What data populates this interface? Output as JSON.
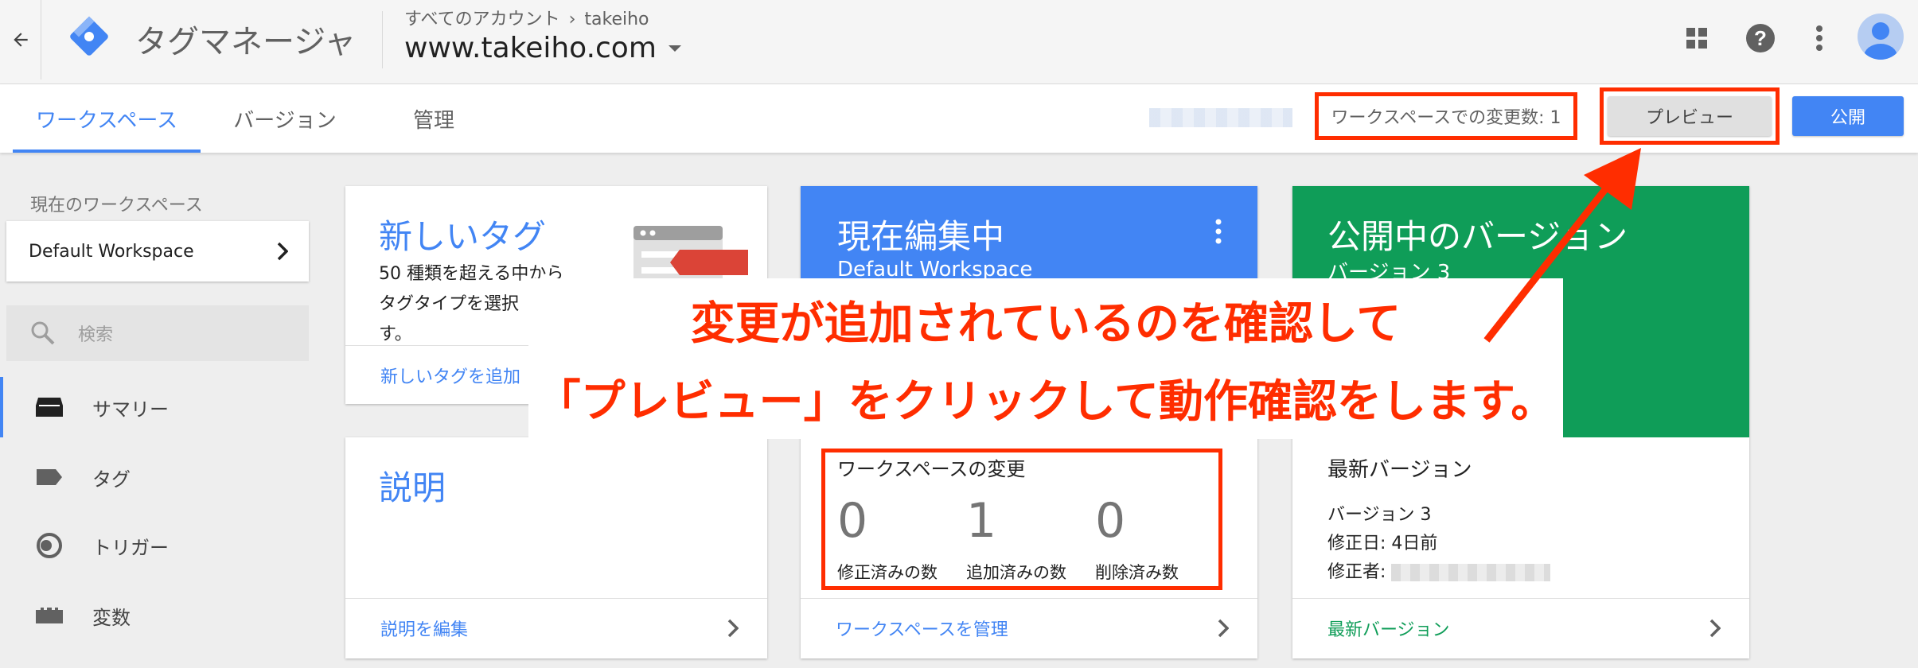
{
  "header": {
    "app_title": "タグマネージャ",
    "breadcrumb_prefix": "すべてのアカウント",
    "breadcrumb_account": "takeiho",
    "container_name": "www.takeiho.com"
  },
  "tabs": [
    {
      "label": "ワークスペース"
    },
    {
      "label": "バージョン"
    },
    {
      "label": "管理"
    }
  ],
  "toolbar": {
    "changes_count": "ワークスペースでの変更数: 1",
    "preview_label": "プレビュー",
    "publish_label": "公開"
  },
  "sidebar": {
    "current_workspace_label": "現在のワークスペース",
    "workspace_name": "Default Workspace",
    "search_placeholder": "検索",
    "items": [
      {
        "label": "サマリー",
        "icon": "summary-icon"
      },
      {
        "label": "タグ",
        "icon": "tag-icon"
      },
      {
        "label": "トリガー",
        "icon": "trigger-icon"
      },
      {
        "label": "変数",
        "icon": "variables-icon"
      }
    ]
  },
  "cards": {
    "new_tag": {
      "title": "新しいタグ",
      "body_l1": "50 種類を超える中から",
      "body_l2": "タグタイプを選択",
      "body_l3": "す。",
      "link": "新しいタグを追加"
    },
    "description": {
      "title": "説明",
      "link": "説明を編集"
    },
    "editing": {
      "title": "現在編集中",
      "subtitle": "Default Workspace",
      "changes_title": "ワークスペースの変更",
      "stats": [
        {
          "value": "0",
          "label": "修正済みの数"
        },
        {
          "value": "1",
          "label": "追加済みの数"
        },
        {
          "value": "0",
          "label": "削除済み数"
        }
      ],
      "link": "ワークスペースを管理"
    },
    "published": {
      "title": "公開中のバージョン",
      "subtitle": "バージョン 3",
      "latest_title": "最新バージョン",
      "version": "バージョン 3",
      "modified": "修正日: 4日前",
      "modifier_label": "修正者:",
      "link": "最新バージョン"
    }
  },
  "annotation": {
    "line1": "変更が追加されているのを確認して",
    "line2": "「プレビュー」をクリックして動作確認をします。"
  },
  "colors": {
    "accent_blue": "#4285f4",
    "published_green": "#0f9d58",
    "annotation_red": "#ff2d00"
  }
}
